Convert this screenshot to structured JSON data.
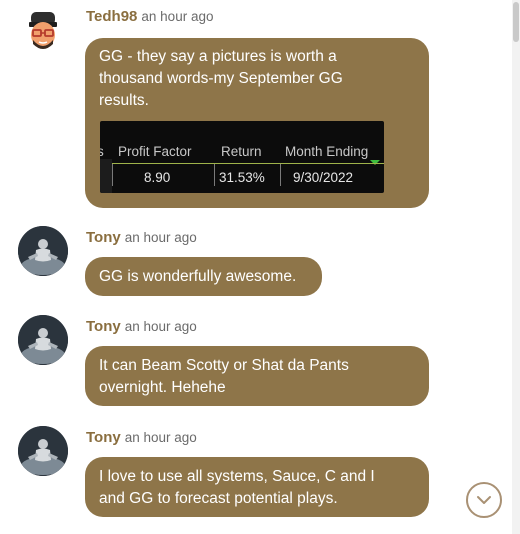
{
  "messages": [
    {
      "author": "Tedh98",
      "time": "an hour ago",
      "text": "GG - they say a pictures is worth a thousand words-my September GG results.",
      "attachment": {
        "headers": [
          "s",
          "Profit Factor",
          "Return",
          "Month Ending"
        ],
        "row": [
          "8.90",
          "31.53%",
          "9/30/2022"
        ]
      }
    },
    {
      "author": "Tony",
      "time": "an hour ago",
      "text": "GG is wonderfully awesome."
    },
    {
      "author": "Tony",
      "time": "an hour ago",
      "text": "It can Beam Scotty or Shat da Pants overnight. Hehehe"
    },
    {
      "author": "Tony",
      "time": "an hour ago",
      "text": "I love to use all systems, Sauce, C and I and GG to forecast potential plays."
    }
  ],
  "colors": {
    "bubble": "#8e7549",
    "author": "#8a6e3f",
    "accent_border": "#a99174"
  },
  "icons": {
    "scroll_down": "chevron-down-icon"
  }
}
